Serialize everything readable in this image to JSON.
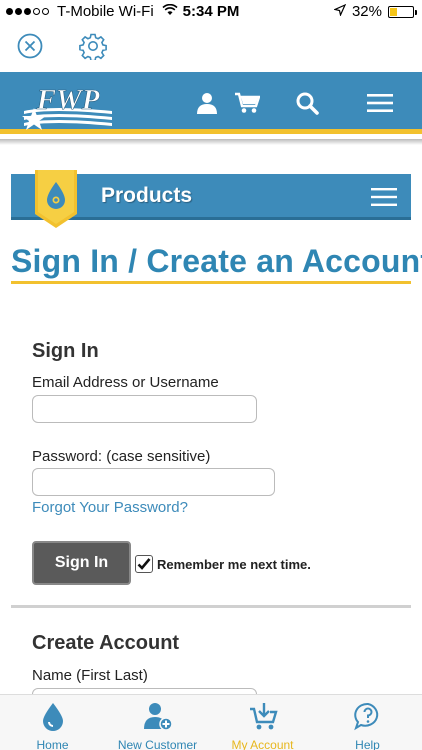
{
  "status_bar": {
    "carrier": "T-Mobile Wi-Fi",
    "time": "5:34 PM",
    "battery": "32%",
    "battery_level": 0.32
  },
  "toolbar": {
    "close_icon": "close-circle-icon",
    "settings_icon": "gear-icon"
  },
  "header": {
    "logo_text": "FWP",
    "icons": [
      "user-icon",
      "cart-icon",
      "search-icon",
      "menu-icon"
    ]
  },
  "products_bar": {
    "title": "Products"
  },
  "page": {
    "title": "Sign In / Create an Account"
  },
  "sign_in": {
    "title": "Sign In",
    "email_label": "Email Address or Username",
    "email_value": "",
    "password_label": "Password: (case sensitive)",
    "password_value": "",
    "forgot_link": "Forgot Your Password?",
    "button_label": "Sign In",
    "remember_label": "Remember me next time.",
    "remember_checked": true
  },
  "create_account": {
    "title": "Create Account",
    "name_label": "Name (First Last)",
    "name_value": ""
  },
  "tab_bar": {
    "tabs": [
      {
        "label": "Home",
        "icon": "water-drop-icon",
        "active": false
      },
      {
        "label": "New Customer",
        "icon": "add-user-icon",
        "active": false
      },
      {
        "label": "My Account",
        "icon": "cart-download-icon",
        "active": true
      },
      {
        "label": "Help",
        "icon": "help-bubble-icon",
        "active": false
      }
    ]
  },
  "colors": {
    "brand_blue": "#3d8bba",
    "accent_yellow": "#f2c12e",
    "active_tab": "#e7b71e"
  }
}
